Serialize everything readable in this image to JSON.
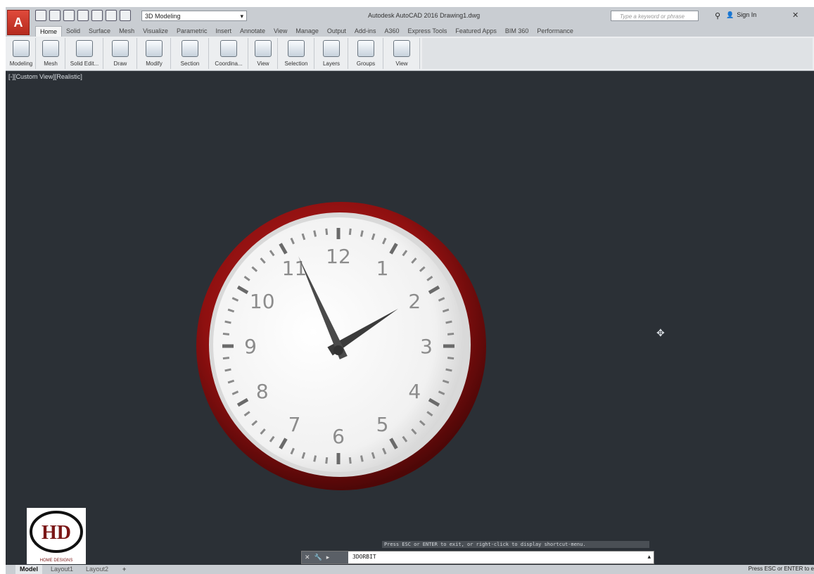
{
  "app": {
    "title": "Autodesk AutoCAD 2016  Drawing1.dwg",
    "workspace": "3D Modeling",
    "search_placeholder": "Type a keyword or phrase",
    "sign_in": "Sign In"
  },
  "tabs": [
    "Home",
    "Solid",
    "Surface",
    "Mesh",
    "Visualize",
    "Parametric",
    "Insert",
    "Annotate",
    "View",
    "Manage",
    "Output",
    "Add-ins",
    "A360",
    "Express Tools",
    "Featured Apps",
    "BIM 360",
    "Performance"
  ],
  "ribbon_panels": [
    "Modeling",
    "Mesh",
    "Solid Edit...",
    "Draw",
    "Modify",
    "Section",
    "Coordina...",
    "View",
    "Selection",
    "Layers",
    "Groups",
    "View"
  ],
  "viewport": {
    "label": "[-][Custom View][Realistic]"
  },
  "clock": {
    "numbers": [
      "12",
      "1",
      "2",
      "3",
      "4",
      "5",
      "6",
      "7",
      "8",
      "9",
      "10",
      "11"
    ],
    "time_hour": 1,
    "time_minute": 56,
    "rim_color": "#8f1010",
    "face_color": "#f2f2f2"
  },
  "logo": {
    "initials": "HD",
    "text": "HOME DESIGNS"
  },
  "command": {
    "prompt": "Press ESC or ENTER to exit, or right-click to display shortcut-menu.",
    "input": "3DORBIT"
  },
  "layout_tabs": [
    "Model",
    "Layout1",
    "Layout2"
  ],
  "status_message": "Press ESC or ENTER to e"
}
